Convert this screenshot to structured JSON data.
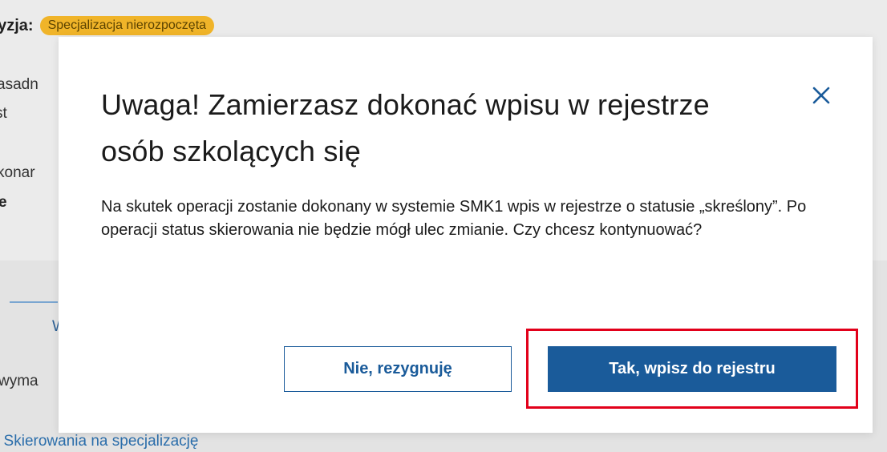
{
  "background": {
    "status_label": "cyzja:",
    "status_badge": "Specjalizacja nierozpoczęta",
    "fragments": [
      "asadn",
      "st",
      "konar",
      "e",
      "W",
      "wyma"
    ],
    "bottom_link": ": Skierowania na specjalizację"
  },
  "modal": {
    "title": "Uwaga! Zamierzasz dokonać wpisu w rejestrze osób szkolących się",
    "body": "Na skutek operacji zostanie dokonany w systemie SMK1 wpis w rejestrze o statusie „skreślony”. Po operacji status skierowania nie będzie mógł ulec zmianie. Czy chcesz kontynuować?",
    "close_icon": "close-icon",
    "cancel_label": "Nie, rezygnuję",
    "confirm_label": "Tak, wpisz do rejestru"
  },
  "colors": {
    "primary": "#1a5b9a",
    "badge": "#f0b429",
    "highlight": "#e2001a"
  }
}
